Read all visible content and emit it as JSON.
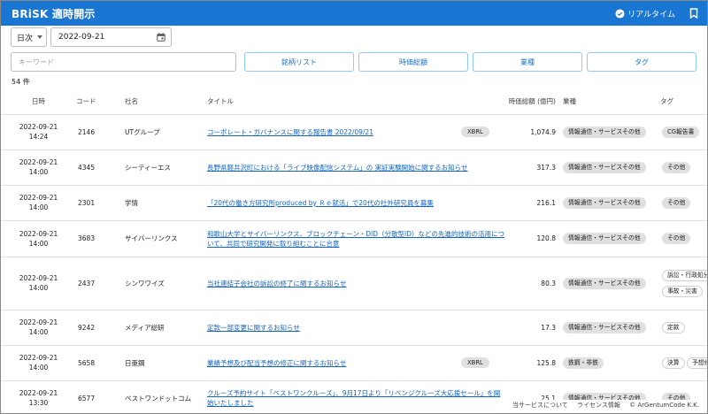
{
  "app": {
    "title": "BRiSK 適時開示",
    "realtime_label": "リアルタイム"
  },
  "filters": {
    "period_select": "日次",
    "date_value": "2022-09-21",
    "keyword_placeholder": "キーワード",
    "buttons": [
      "銘柄リスト",
      "時価総額",
      "業種",
      "タグ"
    ]
  },
  "result_count": "54 件",
  "columns": {
    "datetime": "日時",
    "code": "コード",
    "company": "社名",
    "title": "タイトル",
    "market_cap": "時価総額 (億円)",
    "industry": "業種",
    "tags": "タグ"
  },
  "rows": [
    {
      "date": "2022-09-21",
      "time": "14:24",
      "code": "2146",
      "company": "UTグループ",
      "title": "コーポレート・ガバナンスに関する報告書 2022/09/21",
      "xbrl": "XBRL",
      "market_cap": "1,074.9",
      "industry": "情報通信・サービスその他",
      "tags": [
        "CG報告書"
      ]
    },
    {
      "date": "2022-09-21",
      "time": "14:00",
      "code": "4345",
      "company": "シーティーエス",
      "title": "長野県軽井沢町における「ライブ映像配信システム」の 実証実験開始に関するお知らせ",
      "xbrl": "",
      "market_cap": "317.3",
      "industry": "情報通信・サービスその他",
      "tags": [
        "その他"
      ]
    },
    {
      "date": "2022-09-21",
      "time": "14:00",
      "code": "2301",
      "company": "学情",
      "title": "「20代の働き方研究所produced by Ｒｅ就活」で20代の社外研究員を募集",
      "xbrl": "",
      "market_cap": "216.1",
      "industry": "情報通信・サービスその他",
      "tags": [
        "その他"
      ]
    },
    {
      "date": "2022-09-21",
      "time": "14:00",
      "code": "3683",
      "company": "サイバーリンクス",
      "title": "和歌山大学とサイバーリンクス、ブロックチェーン・DID（分散型ID）などの先進的技術の活用について、共同で研究開発に取り組むことに合意",
      "xbrl": "",
      "market_cap": "120.8",
      "industry": "情報通信・サービスその他",
      "tags": [
        "その他"
      ]
    },
    {
      "date": "2022-09-21",
      "time": "14:00",
      "code": "2437",
      "company": "シンワワイズ",
      "title": "当社連結子会社の訴訟の終了に関するお知らせ",
      "xbrl": "",
      "market_cap": "80.3",
      "industry": "情報通信・サービスその他",
      "tags": [
        "訴訟・行政処分",
        "事故・災害"
      ]
    },
    {
      "date": "2022-09-21",
      "time": "14:00",
      "code": "9242",
      "company": "メディア総研",
      "title": "定款一部変更に関するお知らせ",
      "xbrl": "",
      "market_cap": "17.3",
      "industry": "情報通信・サービスその他",
      "tags": [
        "定款"
      ]
    },
    {
      "date": "2022-09-21",
      "time": "14:00",
      "code": "5658",
      "company": "日亜鋼",
      "title": "業績予想及び配当予想の修正に関するお知らせ",
      "xbrl": "XBRL",
      "market_cap": "125.8",
      "industry": "鉄鋼・非鉄",
      "tags": [
        "決算",
        "予想修正"
      ]
    },
    {
      "date": "2022-09-21",
      "time": "13:30",
      "code": "6577",
      "company": "ベストワンドットコム",
      "title": "クルーズ予約サイト「ベストワンクルーズ」、9月17日より「リベンジクルーズ大応援セール」を開始いたしました",
      "xbrl": "",
      "market_cap": "25.1",
      "industry": "情報通信・サービスその他",
      "tags": [
        "その他"
      ]
    }
  ],
  "footer": {
    "about": "当サービスについて",
    "license": "ライセンス情報",
    "copyright": "© ArGentumCode K.K."
  }
}
